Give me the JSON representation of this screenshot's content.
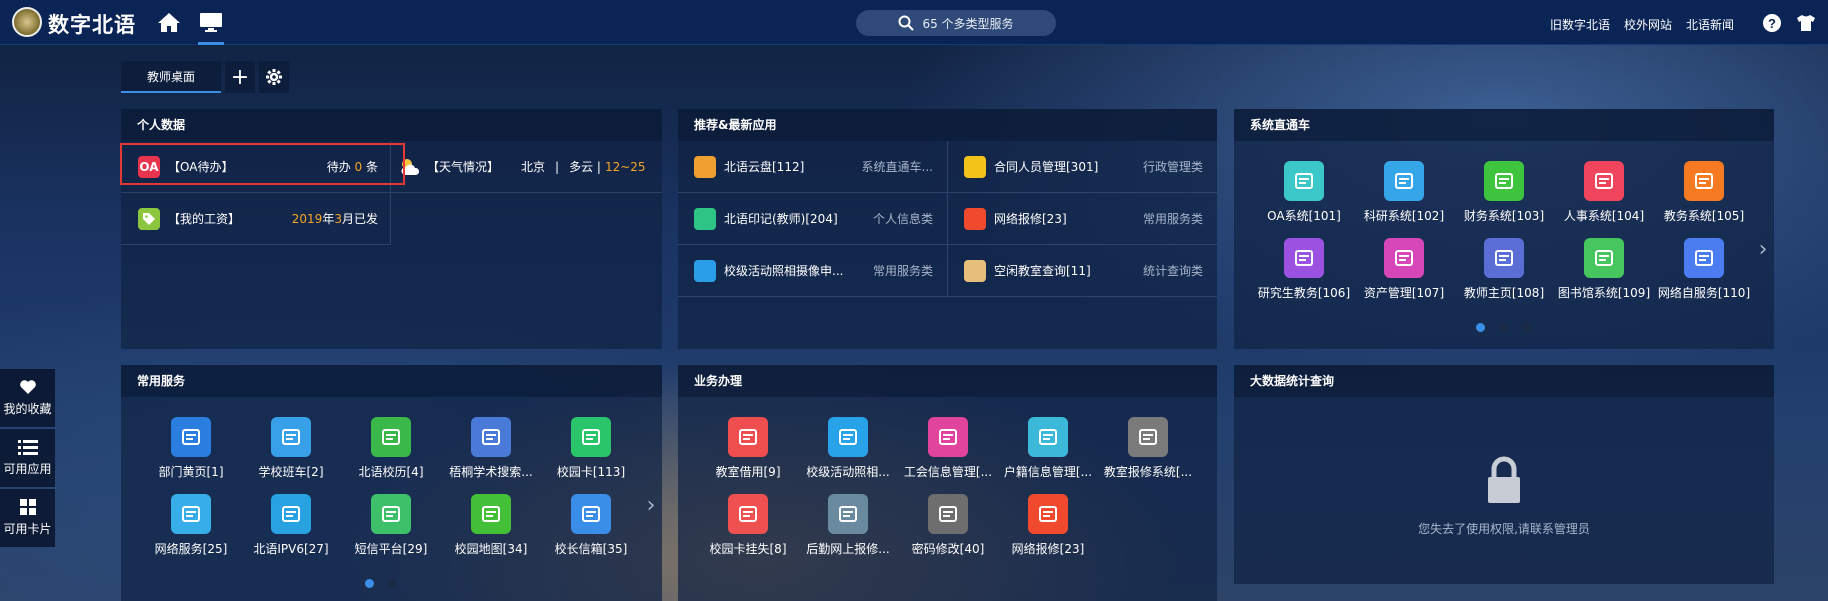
{
  "topbar": {
    "brand": "数字北语",
    "search_text": "65 个多类型服务",
    "links": [
      "旧数字北语",
      "校外网站",
      "北语新闻"
    ]
  },
  "tabs": {
    "active": "教师桌面"
  },
  "sidebar": [
    {
      "label": "我的收藏",
      "icon": "heart-icon"
    },
    {
      "label": "可用应用",
      "icon": "list-icon"
    },
    {
      "label": "可用卡片",
      "icon": "grid-icon"
    }
  ],
  "personal": {
    "title": "个人数据",
    "oa": {
      "label": "【OA待办】",
      "status_prefix": "待办 ",
      "count": "0",
      "status_suffix": " 条",
      "icon": "OA"
    },
    "weather": {
      "label": "【天气情况】",
      "city": "北京",
      "sep": "|",
      "cond": "多云 |",
      "temp": "12~25"
    },
    "salary": {
      "label": "【我的工资】",
      "year": "2019",
      "y_unit": "年",
      "month": "3",
      "m_text": "月已发"
    }
  },
  "recommend": {
    "title": "推荐&最新应用",
    "items": [
      {
        "name": "北语云盘[112]",
        "cat": "系统直通车...",
        "color": "#f0a030"
      },
      {
        "name": "合同人员管理[301]",
        "cat": "行政管理类",
        "color": "#f2c318"
      },
      {
        "name": "北语印记(教师)[204]",
        "cat": "个人信息类",
        "color": "#2ec486"
      },
      {
        "name": "网络报修[23]",
        "cat": "常用服务类",
        "color": "#f04a2e"
      },
      {
        "name": "校级活动照相摄像申...",
        "cat": "常用服务类",
        "color": "#2a9ee8"
      },
      {
        "name": "空闲教室查询[11]",
        "cat": "统计查询类",
        "color": "#e6c07a"
      }
    ]
  },
  "system": {
    "title": "系统直通车",
    "items": [
      {
        "name": "OA系统[101]",
        "color": "#3cc8c8"
      },
      {
        "name": "科研系统[102]",
        "color": "#35a6e8"
      },
      {
        "name": "财务系统[103]",
        "color": "#3ec43e"
      },
      {
        "name": "人事系统[104]",
        "color": "#f0455c"
      },
      {
        "name": "教务系统[105]",
        "color": "#f57a22"
      },
      {
        "name": "研究生教务[106]",
        "color": "#9c52e0"
      },
      {
        "name": "资产管理[107]",
        "color": "#d646b8"
      },
      {
        "name": "教师主页[108]",
        "color": "#5b6ed6"
      },
      {
        "name": "图书馆系统[109]",
        "color": "#46c65e"
      },
      {
        "name": "网络自服务[110]",
        "color": "#4c7df0"
      }
    ]
  },
  "common": {
    "title": "常用服务",
    "items": [
      {
        "name": "部门黄页[1]",
        "color": "#2a7ee0"
      },
      {
        "name": "学校班车[2]",
        "color": "#38a0e8"
      },
      {
        "name": "北语校历[4]",
        "color": "#3ab84a"
      },
      {
        "name": "梧桐学术搜索...",
        "color": "#4a7ad8"
      },
      {
        "name": "校园卡[113]",
        "color": "#2ac46a"
      },
      {
        "name": "网络服务[25]",
        "color": "#38aee8"
      },
      {
        "name": "北语IPV6[27]",
        "color": "#28a2e0"
      },
      {
        "name": "短信平台[29]",
        "color": "#3ec06a"
      },
      {
        "name": "校园地图[34]",
        "color": "#44c038"
      },
      {
        "name": "校长信箱[35]",
        "color": "#3a8ee8"
      }
    ]
  },
  "business": {
    "title": "业务办理",
    "items": [
      {
        "name": "教室借用[9]",
        "color": "#ef4e4e"
      },
      {
        "name": "校级活动照相...",
        "color": "#28a2e8"
      },
      {
        "name": "工会信息管理[...",
        "color": "#e0449c"
      },
      {
        "name": "户籍信息管理[...",
        "color": "#3cb8d8"
      },
      {
        "name": "教室报修系统[...",
        "color": "#7a7a7a"
      },
      {
        "name": "校园卡挂失[8]",
        "color": "#ef5050"
      },
      {
        "name": "后勤网上报修...",
        "color": "#6a8aa0"
      },
      {
        "name": "密码修改[40]",
        "color": "#6e6e6e"
      },
      {
        "name": "网络报修[23]",
        "color": "#f04a2e"
      }
    ]
  },
  "bigdata": {
    "title": "大数据统计查询",
    "message": "您失去了使用权限,请联系管理员"
  }
}
